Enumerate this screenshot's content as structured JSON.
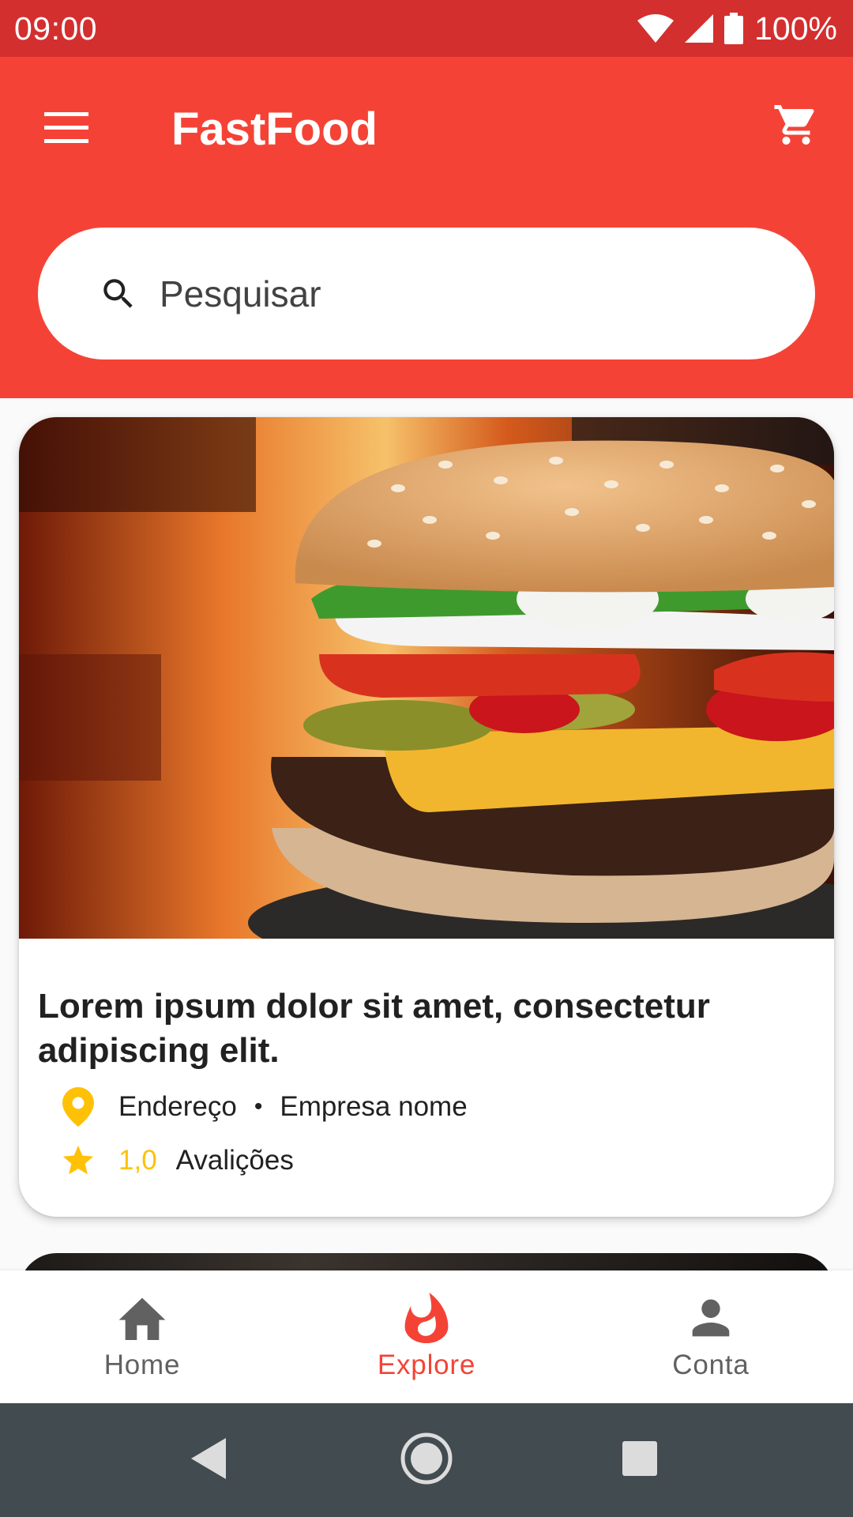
{
  "status_bar": {
    "time": "09:00",
    "battery": "100%",
    "icons": [
      "wifi-icon",
      "cell-signal-icon",
      "battery-icon"
    ]
  },
  "app_bar": {
    "title": "FastFood",
    "menu_icon": "menu-icon",
    "cart_icon": "cart-icon",
    "color": "#f44336",
    "status_color": "#d32f2f"
  },
  "search": {
    "placeholder": "Pesquisar",
    "value": ""
  },
  "cards": [
    {
      "title": "Lorem ipsum dolor sit amet, consectetur adipiscing elit.",
      "address": "Endereço",
      "separator": "•",
      "company": "Empresa nome",
      "rating": "1,0",
      "reviews_label": "Avalições",
      "image": "burger-photo"
    }
  ],
  "bottom_nav": {
    "items": [
      {
        "label": "Home",
        "icon": "home-icon",
        "active": false
      },
      {
        "label": "Explore",
        "icon": "fire-icon",
        "active": true
      },
      {
        "label": "Conta",
        "icon": "person-icon",
        "active": false
      }
    ],
    "active_color": "#f44336",
    "inactive_color": "#616161"
  },
  "accent_star_color": "#ffc107",
  "system_nav": [
    "back-icon",
    "home-circle-icon",
    "recents-icon"
  ]
}
